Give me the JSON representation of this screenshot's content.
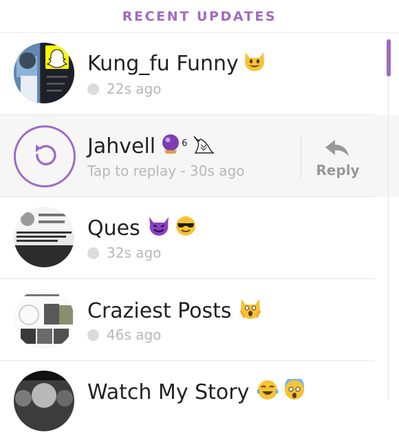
{
  "header": {
    "title": "RECENT UPDATES"
  },
  "colors": {
    "accent": "#9d6bc4",
    "status_dot": "#dcdcdc",
    "muted_text": "#b7b7b7"
  },
  "updates": [
    {
      "name": "Kung_fu Funny",
      "emoji": "smiling-cat-icon",
      "time": "22s ago"
    },
    {
      "name": "Jahvell",
      "emoji": "crystal-ball-icon",
      "superscript": "6",
      "extra_icon": "owl-icon",
      "time": "Tap to replay - 30s ago",
      "action": "Reply"
    },
    {
      "name": "Ques",
      "emoji": [
        "smiling-devil-icon",
        "sunglasses-face-icon"
      ],
      "time": "32s ago"
    },
    {
      "name": "Craziest Posts",
      "emoji": "screaming-cat-icon",
      "time": "46s ago"
    },
    {
      "name": "Watch My Story",
      "emoji": [
        "tears-of-joy-icon",
        "screaming-face-icon"
      ]
    }
  ]
}
